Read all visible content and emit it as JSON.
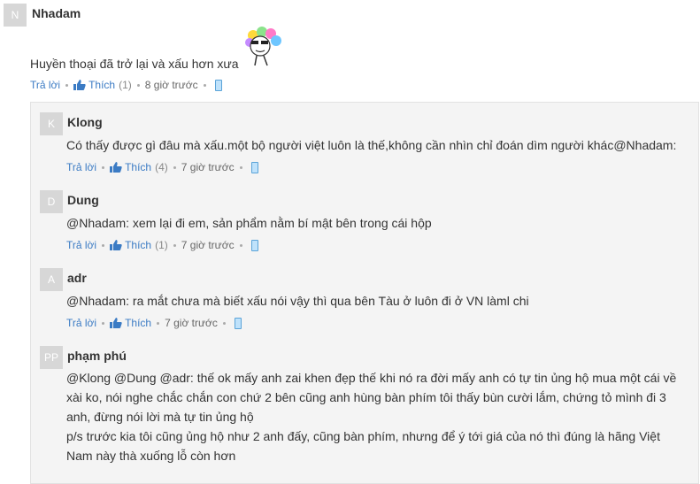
{
  "comment": {
    "avatar": "N",
    "author": "Nhadam",
    "text": "Huyền thoại đã trở lại và xấu hơn xưa",
    "reply_label": "Trả lời",
    "like_label": "Thích",
    "like_count": "(1)",
    "time": "8 giờ trước"
  },
  "replies": [
    {
      "avatar": "K",
      "author": "Klong",
      "text": "Có thấy được gì đâu mà xấu.một bộ người việt luôn là thế,không cần nhìn chỉ đoán dìm người khác@Nhadam:",
      "reply_label": "Trả lời",
      "like_label": "Thích",
      "like_count": "(4)",
      "time": "7 giờ trước"
    },
    {
      "avatar": "D",
      "author": "Dung",
      "text": "@Nhadam: xem lại đi em, sản phẩm nằm bí mật bên trong cái hộp",
      "reply_label": "Trả lời",
      "like_label": "Thích",
      "like_count": "(1)",
      "time": "7 giờ trước"
    },
    {
      "avatar": "A",
      "author": "adr",
      "text": "@Nhadam: ra mắt chưa mà biết xấu nói vậy thì qua bên Tàu ở luôn đi ở VN làml chi",
      "reply_label": "Trả lời",
      "like_label": "Thích",
      "like_count": "",
      "time": "7 giờ trước"
    },
    {
      "avatar": "PP",
      "author": "phạm phú",
      "lines": [
        "@Klong @Dung @adr: thế ok mấy anh zai khen đẹp thế khi nó ra đời mấy anh có tự tin ủng hộ mua một cái về",
        "xài ko, nói nghe chắc chắn con chứ 2 bên cũng anh hùng bàn phím tôi thấy bùn cười lắm, chứng tỏ mình đi 3",
        "anh, đừng nói lời mà tự tin ủng hộ",
        "p/s trước kia tôi cũng ủng hộ như 2 anh đấy, cũng bàn phím, nhưng để ý tới giá của nó thì đúng là hãng Việt",
        "Nam này thà xuống lỗ còn hơn"
      ]
    }
  ],
  "colors": {
    "link": "#3b7bc4",
    "avatar_bg": "#d7d7d7",
    "reply_bg": "#f4f4f4"
  },
  "icons": {
    "like": "thumbs-up-icon",
    "device": "mobile-phone-icon",
    "sticker": "emoji-sticker-icon"
  }
}
